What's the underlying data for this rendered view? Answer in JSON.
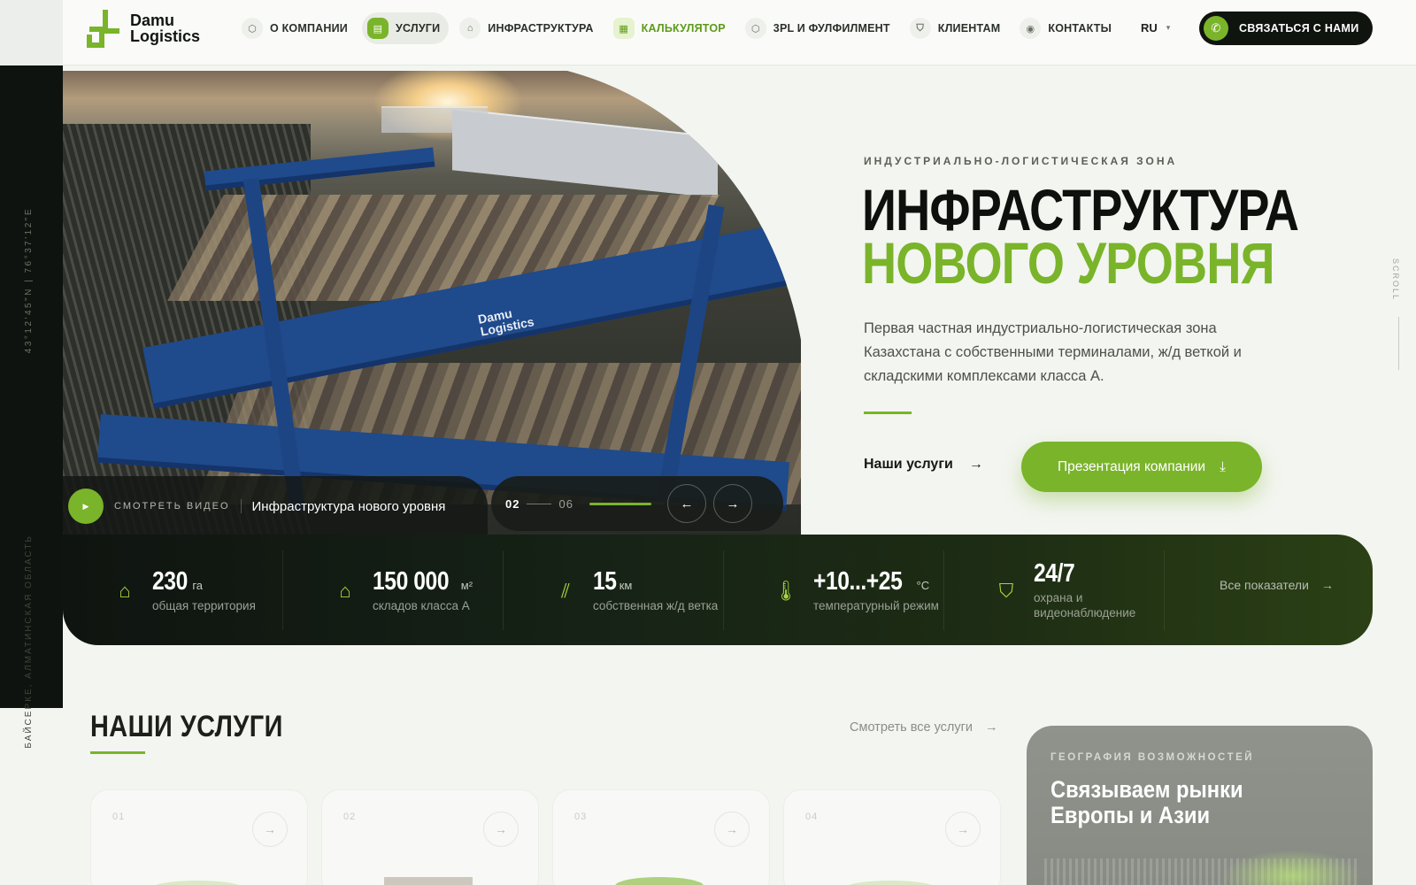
{
  "brand": {
    "line1": "Damu",
    "line2": "Logistics"
  },
  "rail": {
    "coords": "43°12'45\"N  |  76°37'12\"E",
    "region": "БАЙСЕРКЕ, АЛМАТИНСКАЯ ОБЛАСТЬ"
  },
  "nav": [
    {
      "label": "О КОМПАНИИ",
      "icon": "cube-icon"
    },
    {
      "label": "УСЛУГИ",
      "icon": "truck-icon",
      "state": "active"
    },
    {
      "label": "ИНФРАСТРУКТУРА",
      "icon": "warehouse-icon"
    },
    {
      "label": "КАЛЬКУЛЯТОР",
      "icon": "calculator-icon",
      "state": "highlight"
    },
    {
      "label": "3PL И ФУЛФИЛМЕНТ",
      "icon": "box-icon"
    },
    {
      "label": "КЛИЕНТАМ",
      "icon": "shield-icon"
    },
    {
      "label": "КОНТАКТЫ",
      "icon": "pin-icon"
    }
  ],
  "lang": "RU",
  "contact_btn": "СВЯЗАТЬСЯ С НАМИ",
  "hero": {
    "eyebrow": "ИНДУСТРИАЛЬНО-ЛОГИСТИЧЕСКАЯ ЗОНА",
    "title_1": "ИНФРАСТРУКТУРА",
    "title_2": "НОВОГО УРОВНЯ",
    "lead": "Первая частная индустриально-логистическая зона Казахстана с собственными терминалами, ж/д веткой и складскими комплексами класса А.",
    "link_services": "Наши услуги",
    "presentation_btn": "Презентация компании",
    "scroll": "SCROLL"
  },
  "image_brand": {
    "line1": "Damu",
    "line2": "Logistics"
  },
  "video": {
    "label": "СМОТРЕТЬ ВИДЕО",
    "title": "Инфраструктура нового уровня"
  },
  "slider": {
    "current": "02",
    "total": "06",
    "progress": 1.0
  },
  "stats": [
    {
      "value": "230",
      "unit": "га",
      "label": "общая территория",
      "icon": "home-icon"
    },
    {
      "value": "150 000",
      "unit": "м²",
      "label": "складов класса А",
      "icon": "warehouse-icon"
    },
    {
      "value": "15",
      "unit": "км",
      "label": "собственная ж/д ветка",
      "icon": "rail-icon"
    },
    {
      "value": "+10...+25",
      "unit": "°C",
      "label": "температурный режим",
      "icon": "thermometer-icon"
    },
    {
      "value": "24/7",
      "unit": "",
      "label": "охрана и видеонаблюдение",
      "icon": "shield-check-icon"
    }
  ],
  "all_indicators": "Все показатели",
  "services": {
    "title": "НАШИ УСЛУГИ",
    "see_all": "Смотреть все услуги",
    "cards": [
      {
        "num": "01"
      },
      {
        "num": "02"
      },
      {
        "num": "03"
      },
      {
        "num": "04"
      }
    ]
  },
  "geo": {
    "eyebrow": "ГЕОГРАФИЯ ВОЗМОЖНОСТЕЙ",
    "title": "Связываем рынки Европы и Азии"
  },
  "colors": {
    "accent": "#7ab42a",
    "dark": "#10140f"
  }
}
